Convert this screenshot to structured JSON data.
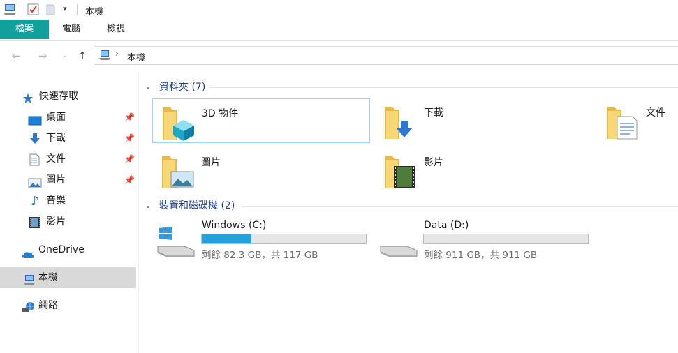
{
  "window": {
    "title": "本機"
  },
  "ribbon": {
    "tabs": [
      "檔案",
      "電腦",
      "檢視"
    ]
  },
  "address": {
    "path": [
      "本機"
    ]
  },
  "sidebar": {
    "quick_access": "快速存取",
    "quick_items": [
      {
        "label": "桌面",
        "pinned": true
      },
      {
        "label": "下載",
        "pinned": true
      },
      {
        "label": "文件",
        "pinned": true
      },
      {
        "label": "圖片",
        "pinned": true
      },
      {
        "label": "音樂",
        "pinned": false
      },
      {
        "label": "影片",
        "pinned": false
      }
    ],
    "onedrive": "OneDrive",
    "this_pc": "本機",
    "network": "網路"
  },
  "folders": {
    "header": "資料夾 (7)",
    "items": [
      "3D 物件",
      "下載",
      "文件",
      "圖片",
      "影片"
    ]
  },
  "drives": {
    "header": "裝置和磁碟機 (2)",
    "items": [
      {
        "name": "Windows (C:)",
        "free": "剩餘 82.3 GB，共 117 GB",
        "used_fraction": 0.3
      },
      {
        "name": "Data (D:)",
        "free": "剩餘 911 GB，共 911 GB",
        "used_fraction": 0.0
      }
    ]
  },
  "colors": {
    "file_tab": "#12a09d",
    "group_header": "#1f3f8f",
    "drive_fill": "#26a0da",
    "selection": "#99d1ff"
  }
}
